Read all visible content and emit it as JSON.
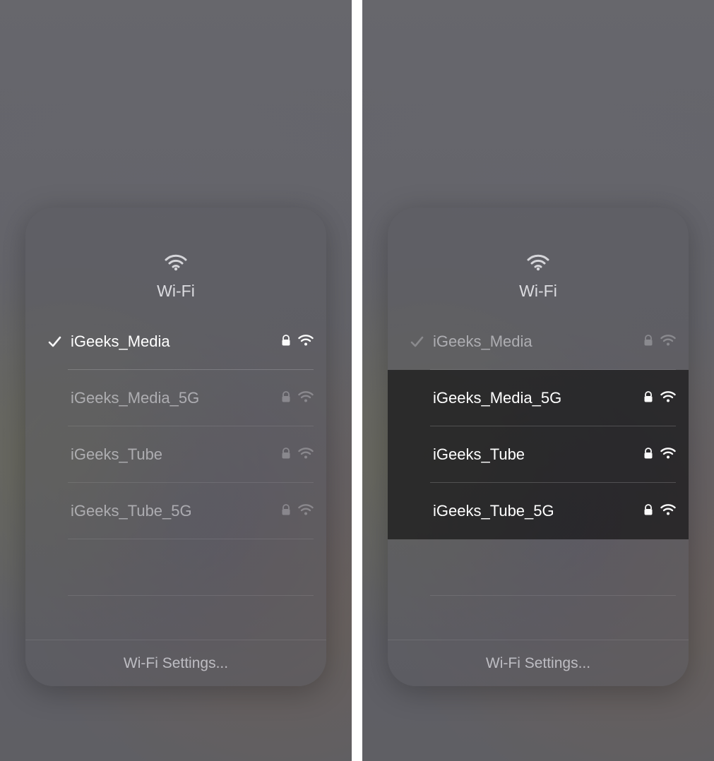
{
  "left": {
    "title": "Wi-Fi",
    "settings_label": "Wi-Fi Settings...",
    "networks": [
      {
        "name": "iGeeks_Media",
        "connected": true,
        "secured": true,
        "highlighted": true
      },
      {
        "name": "iGeeks_Media_5G",
        "connected": false,
        "secured": true,
        "highlighted": false
      },
      {
        "name": "iGeeks_Tube",
        "connected": false,
        "secured": true,
        "highlighted": false
      },
      {
        "name": "iGeeks_Tube_5G",
        "connected": false,
        "secured": true,
        "highlighted": false
      }
    ]
  },
  "right": {
    "title": "Wi-Fi",
    "settings_label": "Wi-Fi Settings...",
    "networks": [
      {
        "name": "iGeeks_Media",
        "connected": true,
        "secured": true,
        "highlighted": false
      },
      {
        "name": "iGeeks_Media_5G",
        "connected": false,
        "secured": true,
        "highlighted": true
      },
      {
        "name": "iGeeks_Tube",
        "connected": false,
        "secured": true,
        "highlighted": true
      },
      {
        "name": "iGeeks_Tube_5G",
        "connected": false,
        "secured": true,
        "highlighted": true
      }
    ]
  }
}
